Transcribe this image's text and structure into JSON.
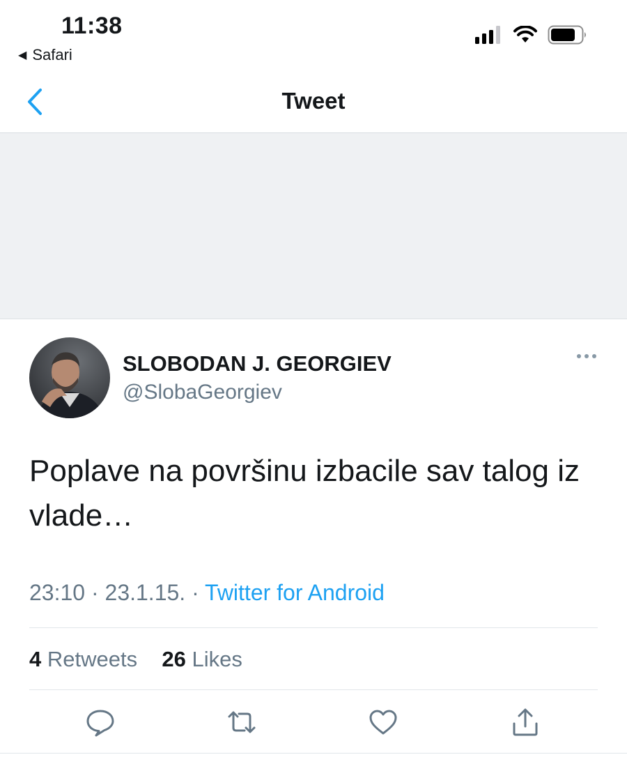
{
  "status_bar": {
    "time": "11:38",
    "back_app": "Safari",
    "icons": [
      "signal-icon",
      "wifi-icon",
      "battery-icon"
    ]
  },
  "nav": {
    "title": "Tweet",
    "back_icon": "chevron-left-icon"
  },
  "tweet": {
    "author_name": "SLOBODAN J. GEORGIEV",
    "author_handle": "@SlobaGeorgiev",
    "text": "Poplave na površinu izbacile sav talog iz vlade…",
    "time": "23:10",
    "date": "23.1.15.",
    "separator": "·",
    "source": "Twitter for Android",
    "retweets_count": "4",
    "retweets_label": "Retweets",
    "likes_count": "26",
    "likes_label": "Likes",
    "actions": [
      "reply-icon",
      "retweet-icon",
      "like-icon",
      "share-icon"
    ]
  },
  "colors": {
    "accent": "#1da1f2",
    "secondary_text": "#657786",
    "background_gray": "#eff1f3"
  }
}
